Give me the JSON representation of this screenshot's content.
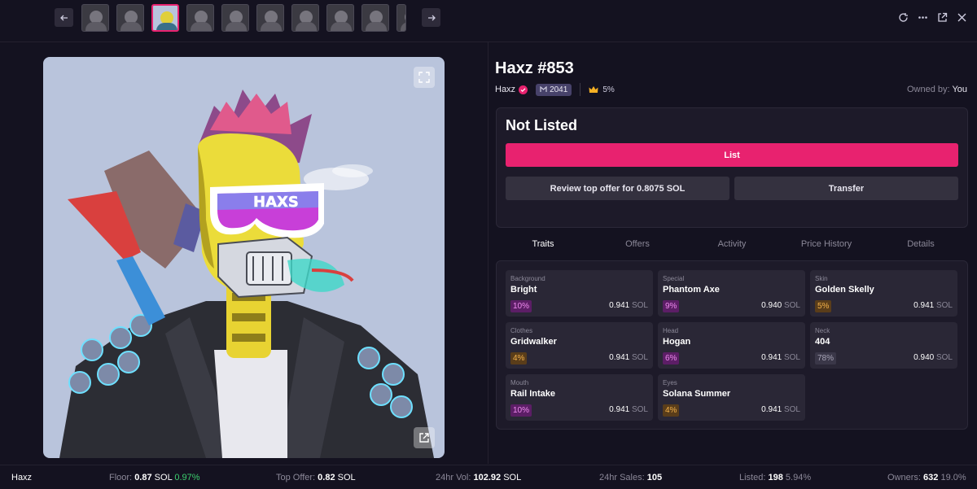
{
  "colors": {
    "accent": "#e8226f",
    "background": "#141220",
    "panel": "#1d1a29",
    "positive": "#3ccf6e"
  },
  "top_bar": {
    "prev_icon": "arrow-left-icon",
    "next_icon": "arrow-right-icon",
    "thumbnails_count": 10,
    "actions": [
      "refresh-icon",
      "more-icon",
      "open-external-icon",
      "close-icon"
    ]
  },
  "nft": {
    "title": "Haxz #853",
    "collection": "Haxz",
    "rank": "2041",
    "royalty": "5%",
    "owned_label": "Owned by:",
    "owner": "You"
  },
  "listing": {
    "status": "Not Listed",
    "list_label": "List",
    "offer_label": "Review top offer for 0.8075 SOL",
    "transfer_label": "Transfer"
  },
  "tabs": [
    "Traits",
    "Offers",
    "Activity",
    "Price History",
    "Details"
  ],
  "traits": [
    {
      "type": "Background",
      "value": "Bright",
      "pct": "10%",
      "price": "0.941",
      "unit": "SOL",
      "tone": "pink"
    },
    {
      "type": "Special",
      "value": "Phantom Axe",
      "pct": "9%",
      "price": "0.940",
      "unit": "SOL",
      "tone": "pink"
    },
    {
      "type": "Skin",
      "value": "Golden Skelly",
      "pct": "5%",
      "price": "0.941",
      "unit": "SOL",
      "tone": "orange"
    },
    {
      "type": "Clothes",
      "value": "Gridwalker",
      "pct": "4%",
      "price": "0.941",
      "unit": "SOL",
      "tone": "orange"
    },
    {
      "type": "Head",
      "value": "Hogan",
      "pct": "6%",
      "price": "0.941",
      "unit": "SOL",
      "tone": "pink"
    },
    {
      "type": "Neck",
      "value": "404",
      "pct": "78%",
      "price": "0.940",
      "unit": "SOL",
      "tone": "gray"
    },
    {
      "type": "Mouth",
      "value": "Rail Intake",
      "pct": "10%",
      "price": "0.941",
      "unit": "SOL",
      "tone": "pink"
    },
    {
      "type": "Eyes",
      "value": "Solana Summer",
      "pct": "4%",
      "price": "0.941",
      "unit": "SOL",
      "tone": "orange"
    }
  ],
  "footer": {
    "collection": "Haxz",
    "floor_label": "Floor:",
    "floor_value": "0.87",
    "floor_unit": "SOL",
    "floor_change": "0.97%",
    "offer_label": "Top Offer:",
    "offer_value": "0.82",
    "offer_unit": "SOL",
    "vol_label": "24hr Vol:",
    "vol_value": "102.92",
    "vol_unit": "SOL",
    "sales_label": "24hr Sales:",
    "sales_value": "105",
    "listed_label": "Listed:",
    "listed_value": "198",
    "listed_pct": "5.94%",
    "owners_label": "Owners:",
    "owners_value": "632",
    "owners_pct": "19.0%"
  }
}
